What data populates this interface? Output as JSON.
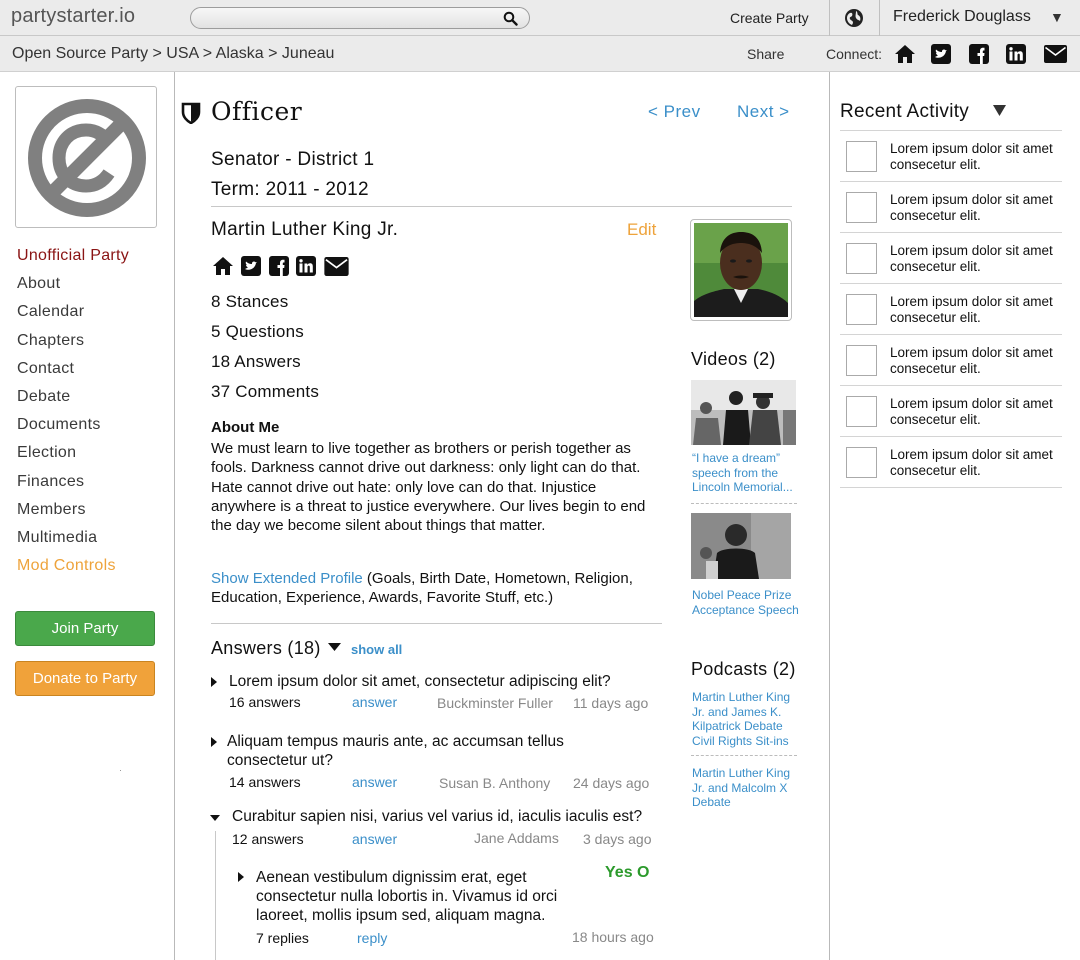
{
  "topbar": {
    "logo": "partystarter.io",
    "search_placeholder": "",
    "create_party": "Create Party",
    "user_name": "Frederick Douglass"
  },
  "subbar": {
    "breadcrumb": "Open Source Party > USA > Alaska > Juneau",
    "share": "Share",
    "connect": "Connect:"
  },
  "sidebar": {
    "items": [
      {
        "label": "Unofficial Party"
      },
      {
        "label": "About"
      },
      {
        "label": "Calendar"
      },
      {
        "label": "Chapters"
      },
      {
        "label": "Contact"
      },
      {
        "label": "Debate"
      },
      {
        "label": "Documents"
      },
      {
        "label": "Election"
      },
      {
        "label": "Finances"
      },
      {
        "label": "Members"
      },
      {
        "label": "Multimedia"
      },
      {
        "label": "Mod Controls"
      }
    ],
    "join_button": "Join Party",
    "donate_button": "Donate to Party"
  },
  "main": {
    "title": "Officer",
    "prev": "< Prev",
    "next": "Next >",
    "office": "Senator - District 1",
    "term": "Term: 2011 - 2012",
    "person_name": "Martin Luther King Jr.",
    "edit": "Edit",
    "stats": [
      "8 Stances",
      "5 Questions",
      "18 Answers",
      "37 Comments"
    ],
    "about_heading": "About Me",
    "about_text": "We must learn to live together as brothers or perish together as fools. Darkness cannot drive out darkness: only light can do that. Hate cannot drive out hate: only love can do that. Injustice anywhere is a threat to justice everywhere. Our lives begin to end the day we become silent about things that matter.",
    "extended_link": "Show Extended Profile",
    "extended_text": " (Goals, Birth Date, Hometown, Religion, Education, Experience,  Awards, Favorite Stuff, etc.)",
    "answers_heading": "Answers (18)",
    "show_all": "show all",
    "questions": [
      {
        "text": "Lorem ipsum dolor sit amet, consectetur adipiscing elit?",
        "count": "16 answers",
        "action": "answer",
        "author": "Buckminster Fuller",
        "time": "11 days ago"
      },
      {
        "text": "Aliquam tempus mauris ante, ac accumsan tellus consectetur ut?",
        "count": "14 answers",
        "action": "answer",
        "author": "Susan B. Anthony",
        "time": "24 days ago"
      },
      {
        "text": "Curabitur sapien nisi, varius vel varius id, iaculis iaculis est?",
        "count": "12 answers",
        "action": "answer",
        "author": "Jane Addams",
        "time": "3 days ago"
      }
    ],
    "reply": {
      "text": "Aenean vestibulum dignissim erat, eget consectetur nulla lobortis in. Vivamus id orci laoreet, mollis ipsum sed, aliquam magna.",
      "vote": "Yes O",
      "count": "7 replies",
      "action": "reply",
      "time": "18 hours ago"
    }
  },
  "media": {
    "videos_heading": "Videos (2)",
    "videos": [
      {
        "title": "“I have a dream” speech from the Lincoln Memorial..."
      },
      {
        "title": "Nobel Peace Prize Acceptance Speech"
      }
    ],
    "podcasts_heading": "Podcasts (2)",
    "podcasts": [
      {
        "title": "Martin Luther King Jr. and James K. Kilpatrick Debate Civil Rights Sit-ins"
      },
      {
        "title": "Martin Luther King Jr. and Malcolm X Debate"
      }
    ]
  },
  "recent_activity": {
    "heading": "Recent Activity",
    "items": [
      {
        "text": "Lorem ipsum dolor sit amet consecetur elit."
      },
      {
        "text": "Lorem ipsum dolor sit amet consecetur elit."
      },
      {
        "text": "Lorem ipsum dolor sit amet consecetur elit."
      },
      {
        "text": "Lorem ipsum dolor sit amet consecetur elit."
      },
      {
        "text": "Lorem ipsum dolor sit amet consecetur elit."
      },
      {
        "text": "Lorem ipsum dolor sit amet consecetur elit."
      },
      {
        "text": "Lorem ipsum dolor sit amet consecetur elit."
      }
    ]
  },
  "colors": {
    "link": "#3b8fc9",
    "accent_orange": "#eea33b",
    "active_red": "#8a1414",
    "join_green": "#4aa84b",
    "yes_green": "#2c9a2c"
  },
  "icons": [
    "search-icon",
    "globe-icon",
    "caret-down-icon",
    "home-icon",
    "twitter-icon",
    "facebook-icon",
    "linkedin-icon",
    "envelope-icon",
    "shield-icon",
    "no-copyright-icon",
    "triangle-right-icon",
    "triangle-down-icon"
  ]
}
